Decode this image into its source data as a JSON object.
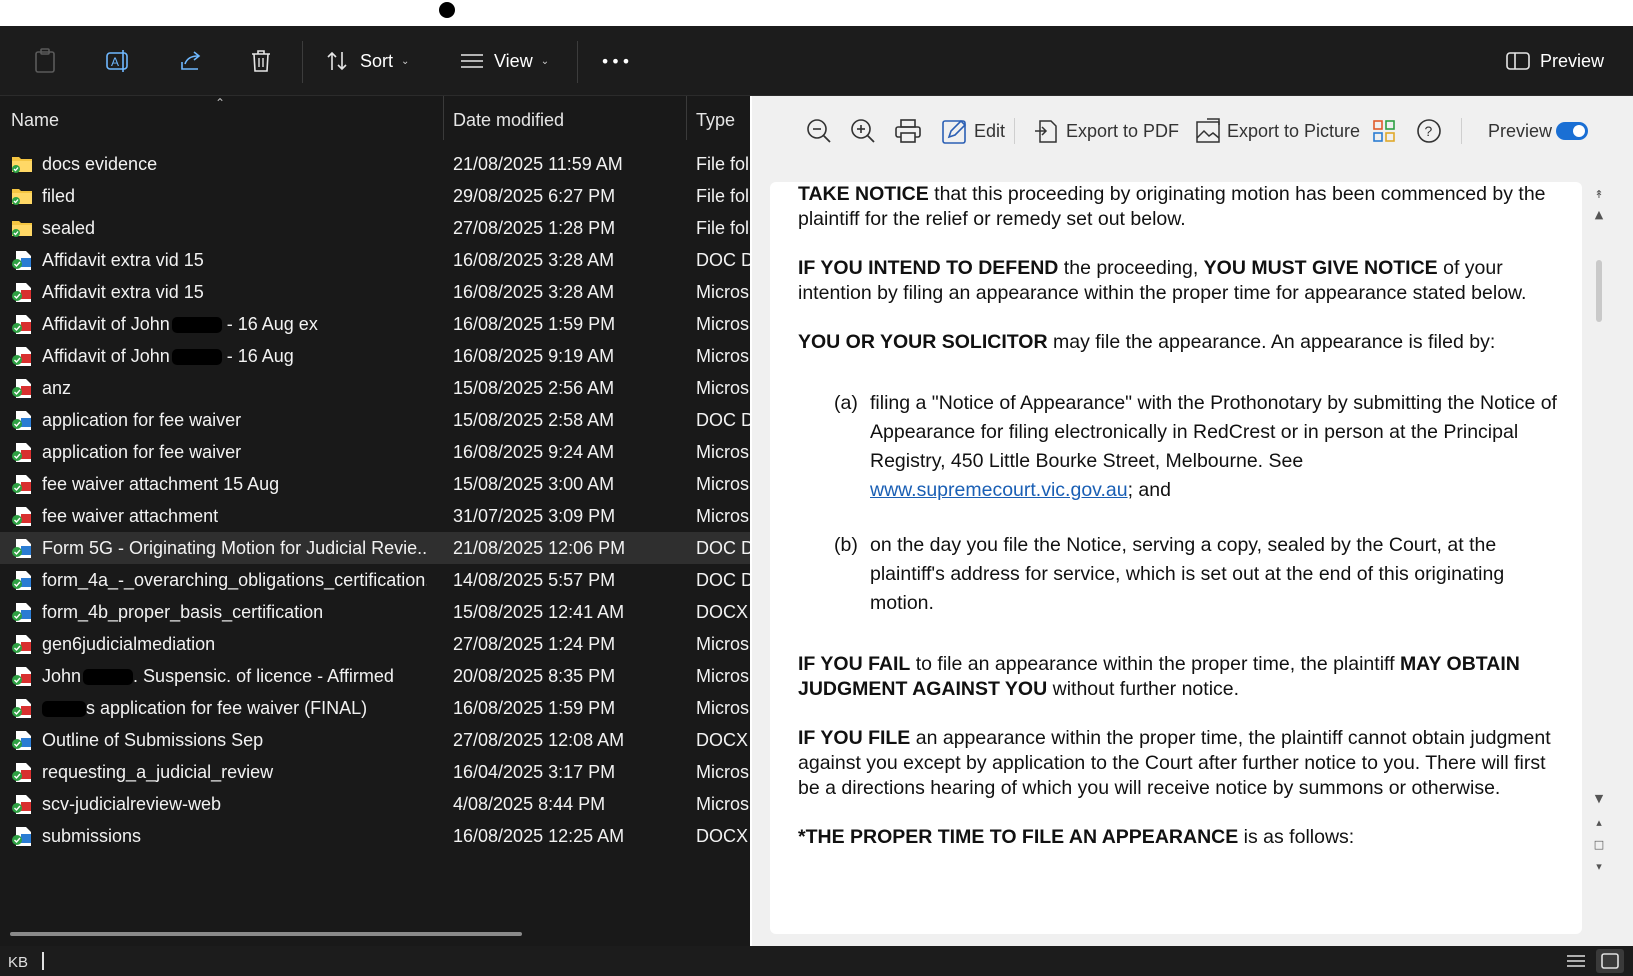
{
  "toolbar": {
    "sort_label": "Sort",
    "view_label": "View",
    "more_label": "•••",
    "preview_label": "Preview"
  },
  "columns": {
    "name": "Name",
    "date": "Date modified",
    "type": "Type"
  },
  "files": [
    {
      "name": "docs evidence",
      "date": "21/08/2025 11:59 AM",
      "type": "File fol",
      "kind": "folder"
    },
    {
      "name": "filed",
      "date": "29/08/2025 6:27 PM",
      "type": "File fol",
      "kind": "folder"
    },
    {
      "name": "sealed",
      "date": "27/08/2025 1:28 PM",
      "type": "File fol",
      "kind": "folder"
    },
    {
      "name": "Affidavit extra vid 15",
      "date": "16/08/2025 3:28 AM",
      "type": "DOC D",
      "kind": "doc"
    },
    {
      "name": "Affidavit extra vid 15",
      "date": "16/08/2025 3:28 AM",
      "type": "Micros",
      "kind": "pdf"
    },
    {
      "name": "Affidavit of John",
      "name_suffix": " - 16 Aug ex",
      "redacted": true,
      "date": "16/08/2025 1:59 PM",
      "type": "Micros",
      "kind": "pdf"
    },
    {
      "name": "Affidavit of John",
      "name_suffix": " - 16 Aug",
      "redacted": true,
      "date": "16/08/2025 9:19 AM",
      "type": "Micros",
      "kind": "pdf"
    },
    {
      "name": "anz",
      "date": "15/08/2025 2:56 AM",
      "type": "Micros",
      "kind": "pdf"
    },
    {
      "name": "application for fee waiver",
      "date": "15/08/2025 2:58 AM",
      "type": "DOC D",
      "kind": "doc"
    },
    {
      "name": "application for fee waiver",
      "date": "16/08/2025 9:24 AM",
      "type": "Micros",
      "kind": "pdf"
    },
    {
      "name": "fee waiver attachment 15 Aug",
      "date": "15/08/2025 3:00 AM",
      "type": "Micros",
      "kind": "pdf"
    },
    {
      "name": "fee waiver attachment",
      "date": "31/07/2025 3:09 PM",
      "type": "Micros",
      "kind": "pdf"
    },
    {
      "name": "Form 5G - Originating Motion for Judicial Revie...",
      "date": "21/08/2025 12:06 PM",
      "type": "DOC D",
      "kind": "doc",
      "selected": true
    },
    {
      "name": "form_4a_-_overarching_obligations_certification...",
      "date": "14/08/2025 5:57 PM",
      "type": "DOC D",
      "kind": "doc"
    },
    {
      "name": "form_4b_proper_basis_certification",
      "date": "15/08/2025 12:41 AM",
      "type": "DOCX",
      "kind": "doc"
    },
    {
      "name": "gen6judicialmediation",
      "date": "27/08/2025 1:24 PM",
      "type": "Micros",
      "kind": "pdf"
    },
    {
      "name": "John",
      "name_suffix": ". Suspensic. of licence - Affirmed",
      "redacted": true,
      "date": "20/08/2025 8:35 PM",
      "type": "Micros",
      "kind": "pdf"
    },
    {
      "name": "",
      "name_suffix": "s application for fee waiver (FINAL)",
      "redacted": true,
      "date": "16/08/2025 1:59 PM",
      "type": "Micros",
      "kind": "pdf"
    },
    {
      "name": "Outline of Submissions Sep",
      "date": "27/08/2025 12:08 AM",
      "type": "DOCX",
      "kind": "doc"
    },
    {
      "name": "requesting_a_judicial_review",
      "date": "16/04/2025 3:17 PM",
      "type": "Micros",
      "kind": "pdf"
    },
    {
      "name": "scv-judicialreview-web",
      "date": "4/08/2025 8:44 PM",
      "type": "Micros",
      "kind": "pdf"
    },
    {
      "name": "submissions",
      "date": "16/08/2025 12:25 AM",
      "type": "DOCX",
      "kind": "doc"
    }
  ],
  "status": {
    "kb": "KB"
  },
  "preview_toolbar": {
    "edit": "Edit",
    "export_pdf": "Export to PDF",
    "export_picture": "Export to Picture",
    "preview": "Preview"
  },
  "document": {
    "p1_b": "TAKE NOTICE",
    "p1": " that this proceeding by originating motion has been commenced by the plaintiff for the relief or remedy set out below.",
    "p2_b1": "IF YOU INTEND TO DEFEND",
    "p2_a": " the proceeding, ",
    "p2_b2": "YOU MUST GIVE NOTICE",
    "p2_c": " of your intention by filing an appearance within the proper time for appearance stated below.",
    "p3_b": "YOU OR YOUR SOLICITOR",
    "p3": " may file the appearance. An appearance is filed by:",
    "a_label": "(a)",
    "a_text": "filing a \"Notice of Appearance\" with the Prothonotary by submitting the Notice of Appearance for filing electronically in RedCrest or in person at the Principal Registry, 450 Little Bourke Street, Melbourne. See ",
    "a_link": "www.supremecourt.vic.gov.au",
    "a_end": "; and",
    "b_label": "(b)",
    "b_text": "on the day you file the Notice, serving a copy, sealed by the Court, at the plaintiff's address for service, which is set out at the end of this originating motion.",
    "p4_b1": "IF YOU FAIL",
    "p4_a": " to file an appearance within the proper time, the plaintiff ",
    "p4_b2": "MAY OBTAIN JUDGMENT AGAINST YOU",
    "p4_c": " without further notice.",
    "p5_b": "IF YOU FILE",
    "p5": " an appearance within the proper time, the plaintiff cannot obtain judgment against you except by application to the Court after further notice to you. There will first be a directions hearing of which you will receive notice by summons or otherwise.",
    "p6_b": "*THE PROPER TIME TO FILE AN APPEARANCE",
    "p6": " is as follows:"
  },
  "colors": {
    "toolbar_bg": "#1c1c1c",
    "list_bg": "#191919",
    "selected_row": "#2f2f2f",
    "accent": "#1a6fd4",
    "folder": "#f4c542",
    "pdf_red": "#d8302f",
    "doc_blue": "#2b7cd3",
    "sync_green": "#2ea043"
  }
}
